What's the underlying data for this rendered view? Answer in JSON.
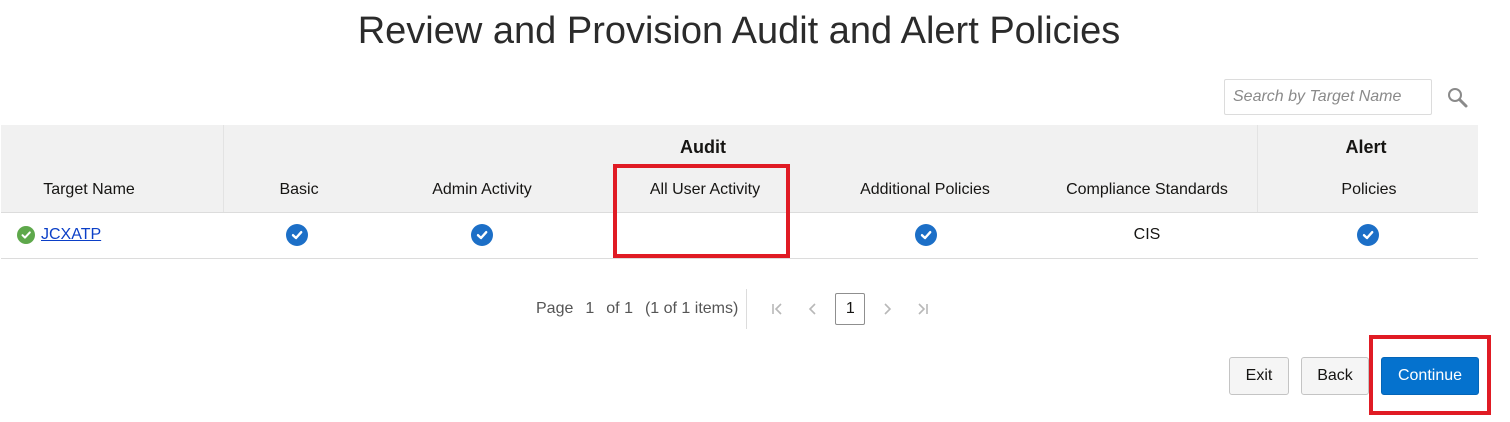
{
  "page": {
    "title": "Review and Provision Audit and Alert Policies"
  },
  "search": {
    "placeholder": "Search by Target Name"
  },
  "table": {
    "group_headers": {
      "audit": "Audit",
      "alert": "Alert"
    },
    "columns": {
      "target_name": "Target Name",
      "basic": "Basic",
      "admin_activity": "Admin Activity",
      "all_user_activity": "All User Activity",
      "additional_policies": "Additional Policies",
      "compliance_standards": "Compliance Standards",
      "policies": "Policies"
    },
    "rows": [
      {
        "target_name": "JCXATP",
        "status": "ok",
        "basic": true,
        "admin_activity": true,
        "all_user_activity": false,
        "additional_policies": true,
        "compliance_standards": "CIS",
        "alert_policies": true
      }
    ]
  },
  "pagination": {
    "page_label": "Page",
    "current_page": "1",
    "of_label": "of 1",
    "items_label": "(1 of 1 items)",
    "page_button": "1"
  },
  "buttons": {
    "exit": "Exit",
    "back": "Back",
    "continue": "Continue"
  },
  "colors": {
    "accent": "#0572ce",
    "check": "#1c6fc7",
    "status_ok": "#5ea84b",
    "highlight": "#e01b24"
  },
  "icons": {
    "search": "search-icon",
    "check": "check-circle-icon",
    "status": "status-ok-icon"
  }
}
